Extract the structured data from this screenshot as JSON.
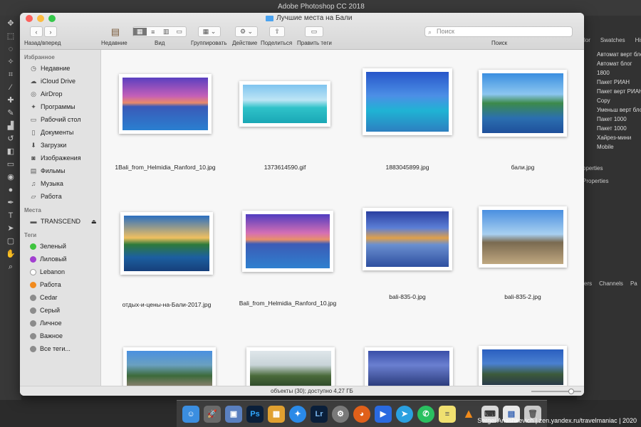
{
  "photoshop": {
    "title": "Adobe Photoshop CC 2018",
    "right_tabs": [
      "lor",
      "Swatches",
      "History"
    ],
    "actions": [
      "Автомат верт блог",
      "Автомат блог",
      "1800",
      "Пакет РИАН",
      "Пакет верт РИАН",
      "Copy",
      "Уменьш верт блог",
      "Пакет 1000",
      "Пакет 1000",
      "Хайрез-мини",
      "Mobile"
    ],
    "properties": [
      "operties",
      "Properties"
    ],
    "layer_tabs": [
      "ers",
      "Channels",
      "Pa"
    ]
  },
  "finder": {
    "window_title": "Лучшие места на Бали",
    "toolbar": {
      "nav_label": "Назад/вперед",
      "recents_label": "Недавние",
      "view_label": "Вид",
      "group_label": "Группировать",
      "action_label": "Действие",
      "share_label": "Поделиться",
      "tags_label": "Править теги",
      "search_label": "Поиск",
      "search_placeholder": "Поиск"
    },
    "sidebar": {
      "favorites_header": "Избранное",
      "favorites": [
        {
          "icon": "clock-icon",
          "label": "Недавние"
        },
        {
          "icon": "cloud-icon",
          "label": "iCloud Drive"
        },
        {
          "icon": "airdrop-icon",
          "label": "AirDrop"
        },
        {
          "icon": "apps-icon",
          "label": "Программы"
        },
        {
          "icon": "desktop-icon",
          "label": "Рабочий стол"
        },
        {
          "icon": "document-icon",
          "label": "Документы"
        },
        {
          "icon": "download-icon",
          "label": "Загрузки"
        },
        {
          "icon": "camera-icon",
          "label": "Изображения"
        },
        {
          "icon": "film-icon",
          "label": "Фильмы"
        },
        {
          "icon": "music-icon",
          "label": "Музыка"
        },
        {
          "icon": "folder-icon",
          "label": "Работа"
        }
      ],
      "places_header": "Места",
      "places": [
        {
          "icon": "drive-icon",
          "label": "TRANSCEND"
        }
      ],
      "tags_header": "Теги",
      "tags": [
        {
          "color": "#3ec43e",
          "label": "Зеленый"
        },
        {
          "color": "#a23fd0",
          "label": "Лиловый"
        },
        {
          "color": "#ffffff",
          "label": "Lebanon"
        },
        {
          "color": "#f28b1e",
          "label": "Работа"
        },
        {
          "color": "#8c8c8c",
          "label": "Cedar"
        },
        {
          "color": "#8c8c8c",
          "label": "Серый"
        },
        {
          "color": "#8c8c8c",
          "label": "Личное"
        },
        {
          "color": "#8c8c8c",
          "label": "Важное"
        },
        {
          "color": "#8c8c8c",
          "label": "Все теги..."
        }
      ]
    },
    "files": [
      "1Bali_from_Helmidia_Ranford_10.jpg",
      "1373614590.gif",
      "1883045899.jpg",
      "бали.jpg",
      "отдых-и-цены-на-Бали-2017.jpg",
      "Bali_from_Helmidia_Ranford_10.jpg",
      "bali-835-0.jpg",
      "bali-835-2.jpg"
    ],
    "status": "объекты (30); доступно 4,27 ГБ"
  },
  "dock": [
    "finder-icon",
    "launchpad-icon",
    "preview-icon",
    "photoshop-icon",
    "photo-icon",
    "safari-icon",
    "lightroom-icon",
    "settings-icon",
    "firefox-icon",
    "zoom-icon",
    "telegram-icon",
    "whatsapp-icon",
    "notes-icon",
    "vlc-icon",
    "keyboard-icon",
    "word-icon",
    "trash-icon"
  ],
  "dock_labels": {
    "ps": "Ps",
    "lr": "Lr"
  },
  "credit": "Sergei Anashkevich | zen.yandex.ru/travelmaniac | 2020"
}
